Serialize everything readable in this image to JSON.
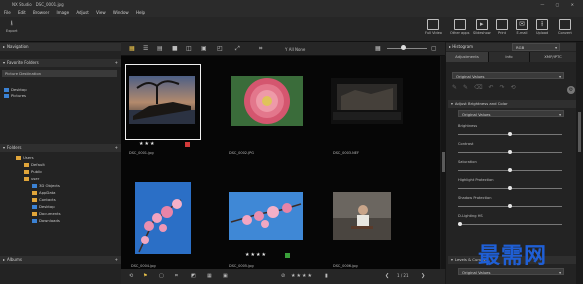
{
  "window": {
    "title": "NX Studio",
    "file": "DSC_0001.jpg",
    "controls": "— ▢ ✕"
  },
  "menu": [
    "File",
    "Edit",
    "Browser",
    "Image",
    "Adjust",
    "View",
    "Window",
    "Help"
  ],
  "toolbar": {
    "export_label": "Export",
    "buttons": [
      "Full Video",
      "Other apps",
      "Slideshow",
      "Print",
      "E-mail",
      "Upload",
      "Convert"
    ]
  },
  "left": {
    "navigation": "Navigation",
    "favorite": "Favorite Folders",
    "add_label": "Picture Destination",
    "favorites": [
      "Desktop",
      "Pictures"
    ],
    "folders": "Folders",
    "tree": [
      {
        "label": "Users",
        "indent": 0
      },
      {
        "label": "Default",
        "indent": 1
      },
      {
        "label": "Public",
        "indent": 1
      },
      {
        "label": "user",
        "indent": 1
      },
      {
        "label": "3D Objects",
        "indent": 2
      },
      {
        "label": "AppData",
        "indent": 2
      },
      {
        "label": "Contacts",
        "indent": 2
      },
      {
        "label": "Desktop",
        "indent": 2
      },
      {
        "label": "Documents",
        "indent": 2
      },
      {
        "label": "Downloads",
        "indent": 2
      }
    ],
    "albums": "Albums"
  },
  "viewer": {
    "filter_label": "Y  All None",
    "thumbnails": [
      {
        "name": "DSC_0001.jpg",
        "stars": "★★★",
        "tag": "red"
      },
      {
        "name": "DSC_0002.JPG",
        "stars": "",
        "tag": ""
      },
      {
        "name": "DSC_0003.NEF",
        "stars": "",
        "tag": ""
      },
      {
        "name": "DSC_0004.jpg",
        "stars": "",
        "tag": ""
      },
      {
        "name": "DSC_0005.jpg",
        "stars": "★★★★",
        "tag": "green"
      },
      {
        "name": "DSC_0006.jpg",
        "stars": "",
        "tag": ""
      }
    ],
    "page": "1 / 21",
    "rating": "★★★★"
  },
  "right": {
    "histogram": "Histogram",
    "histogram_mode": "RGB",
    "tabs": [
      "Adjustments",
      "Info",
      "XMP/IPTC"
    ],
    "preset": "Original Values",
    "section": "Adjust Brightness and Color",
    "mode": "Original Values",
    "sliders": [
      {
        "label": "Brightness",
        "value": 0.5
      },
      {
        "label": "Contrast",
        "value": 0.5
      },
      {
        "label": "Saturation",
        "value": 0.5
      },
      {
        "label": "Highlight Protection",
        "value": 0.5
      },
      {
        "label": "Shadow Protection",
        "value": 0.5
      },
      {
        "label": "D-Lighting HS",
        "value": 0.0
      }
    ],
    "levels": "Levels & Curves",
    "levels_mode": "Original Values"
  },
  "watermark": "最需网"
}
